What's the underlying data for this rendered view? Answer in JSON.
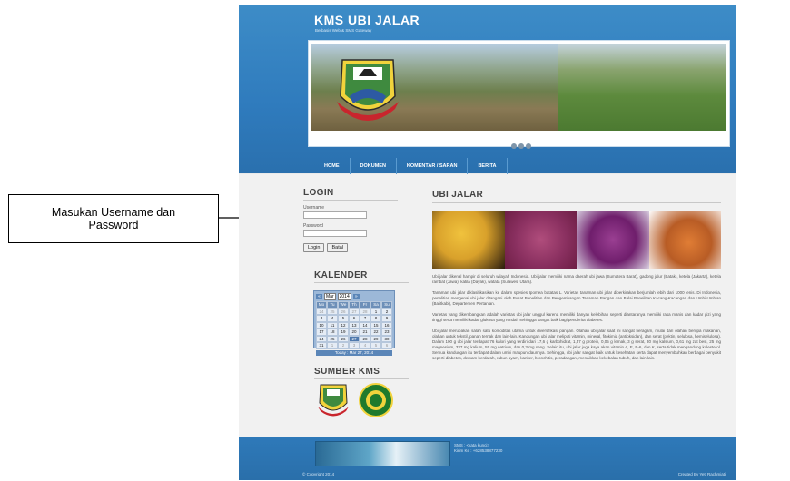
{
  "callout": {
    "line1": "Masukan Username dan",
    "line2": "Password"
  },
  "site": {
    "title": "KMS UBI JALAR",
    "subtitle": "Berbasis Web & SMS Gateway"
  },
  "nav": {
    "items": [
      "HOME",
      "DOKUMEN",
      "KOMENTAR / SARAN",
      "BERITA"
    ]
  },
  "login": {
    "title": "LOGIN",
    "username_label": "Username",
    "password_label": "Password",
    "login_button": "Login",
    "cancel_button": "Batal"
  },
  "calendar": {
    "title": "KALENDER",
    "month": "Mar",
    "year": "2014",
    "weekdays": [
      "Mo",
      "Tu",
      "We",
      "Th",
      "Fr",
      "Sa",
      "Su"
    ],
    "days": [
      "24",
      "25",
      "26",
      "27",
      "28",
      "1",
      "2",
      "3",
      "4",
      "5",
      "6",
      "7",
      "8",
      "9",
      "10",
      "11",
      "12",
      "13",
      "14",
      "15",
      "16",
      "17",
      "18",
      "19",
      "20",
      "21",
      "22",
      "23",
      "24",
      "25",
      "26",
      "27",
      "28",
      "29",
      "30",
      "31",
      "1",
      "2",
      "3",
      "4",
      "5",
      "6"
    ],
    "today_label": "Today : Mar 27, 2014"
  },
  "sumber": {
    "title": "SUMBER KMS"
  },
  "article": {
    "title": "UBI JALAR",
    "paragraphs": [
      "Ubi jalar dikenal hampir di seluruh wilayah Indonesia. Ubi jalar memiliki nama daerah ubi jawa (Sumatera Barat), gadong jalur (Batak), ketela (Jakarta), ketela rambat (Jawa), katila (Dayak), watata (Sulawesi Utara).",
      "Tanaman ubi jalar diklasifikasikan ke dalam spesies Ipomea batatas L. Varietas tanaman ubi jalar diperkirakan berjumlah lebih dari 1000 jenis. Di Indonesia, penelitian mengenai ubi jalar ditangani oleh Pusat Penelitian dan Pengembangan Tanaman Pangan dan Balai Penelitian Kacang-Kacangan dan Umbi-Umbian (Balitkabi), Departemen Pertanian.",
      "Varietas yang dikembangkan adalah varietas ubi jalar unggul karena memiliki banyak kelebihan seperti diantaranya memiliki rasa manis dan kadar gizi yang tinggi serta memiliki kadar glukosa yang rendah sehingga sangat baik bagi penderita diabetes.",
      "Ubi jalar merupakan salah satu komoditas utama untuk diversifikasi pangan. Olahan ubi jalar saat ini sangat beragam, mulai dari olahan berupa makanan, olahan untuk tekstil, panan ternak dan lain-lain. Kandungan ubi jalar meliputi vitamin, mineral, fitokimia (antioksidan), dan serat (pektin, selulosa, hemiselulosa). Dalam 100 g ubi jalar terdapat 76 kalori yang terdiri dari 17,6 g karbohidrat, 1,57 g protein, 0,05 g lemak, 3 g serat, 30 mg kalsium, 0,61 mg zat besi, 25 mg magnesium, 337 mg kalium, 55 mg natrium, dan 0,3 mg seng. Selain itu, ubi jalar juga kaya akan vitamin A, E, B-6, dan K, serta tidak mengandung kolesterol. Semua kandungan itu terdapat dalam umbi maupun daunnya. Sehingga, ubi jalar sangat baik untuk kesehatan serta dapat menyembuhkan berbagai penyakit seperti diabetes, demam berdarah, rabun ayam, kanker, bronchitis, peradangan, menaikkan kekebalan tubuh, dan lain-lain."
    ]
  },
  "footer": {
    "contact_line1": "SMS : <kata kunci>",
    "contact_line2": "Kirim Ke : +628538877230",
    "copyright": "© Copyright 2014",
    "credit": "Created By Yeti Rachmiati"
  },
  "colors": {
    "header_blue": "#2f7bbd",
    "nav_blue": "#2a70ae",
    "content_bg": "#f1f1f1"
  },
  "icons": {
    "banner_logo": "regency-emblem",
    "sumber_logo_1": "regency-emblem",
    "sumber_logo_2": "green-seal"
  }
}
